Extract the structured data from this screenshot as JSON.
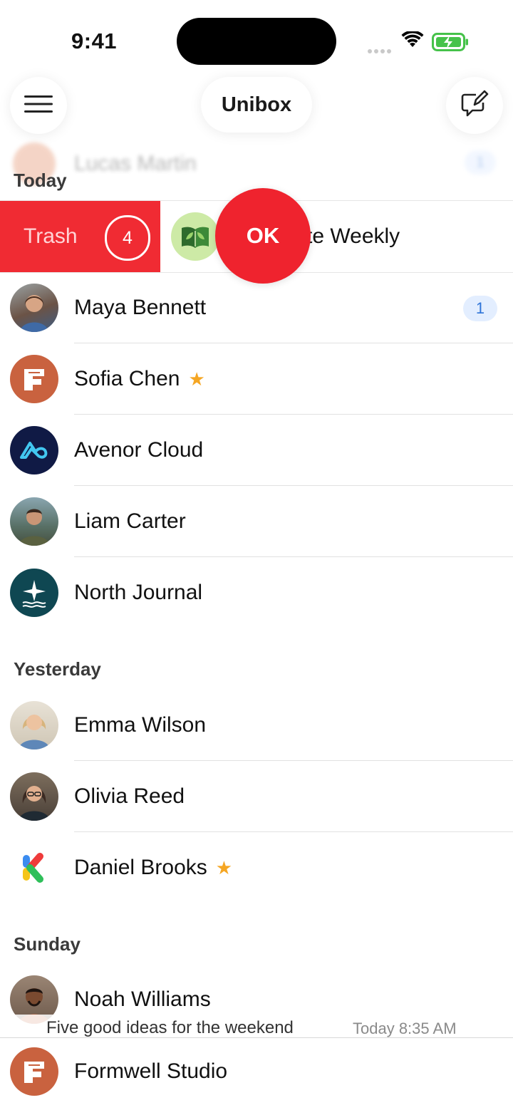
{
  "status": {
    "time": "9:41"
  },
  "nav": {
    "title": "Unibox",
    "menu_icon": "hamburger-icon",
    "compose_icon": "compose-icon"
  },
  "ghost_row": {
    "name": "Lucas Martin",
    "badge": "1"
  },
  "sections": {
    "today": "Today",
    "yesterday": "Yesterday",
    "sunday": "Sunday"
  },
  "swipe": {
    "action_label": "Trash",
    "count": "4",
    "partial_name": "te Weekly",
    "ok_label": "OK"
  },
  "rows": [
    {
      "name": "Maya Bennett",
      "badge": "1",
      "starred": false
    },
    {
      "name": "Sofia Chen",
      "starred": true
    },
    {
      "name": "Avenor Cloud",
      "starred": false
    },
    {
      "name": "Liam Carter",
      "starred": false
    },
    {
      "name": "North Journal",
      "starred": false
    },
    {
      "name": "Emma Wilson",
      "starred": false
    },
    {
      "name": "Olivia Reed",
      "starred": false
    },
    {
      "name": "Daniel Brooks",
      "starred": true
    },
    {
      "name": "Noah Williams",
      "starred": false
    },
    {
      "name": "Formwell Studio",
      "starred": false
    }
  ],
  "star_glyph": "★",
  "preview": {
    "text": "Five good ideas for the weekend",
    "time": "Today 8:35 AM"
  },
  "colors": {
    "accent_red": "#f02b33",
    "star": "#f5a623",
    "badge_bg": "#e3eeff",
    "badge_text": "#2f74d8"
  }
}
